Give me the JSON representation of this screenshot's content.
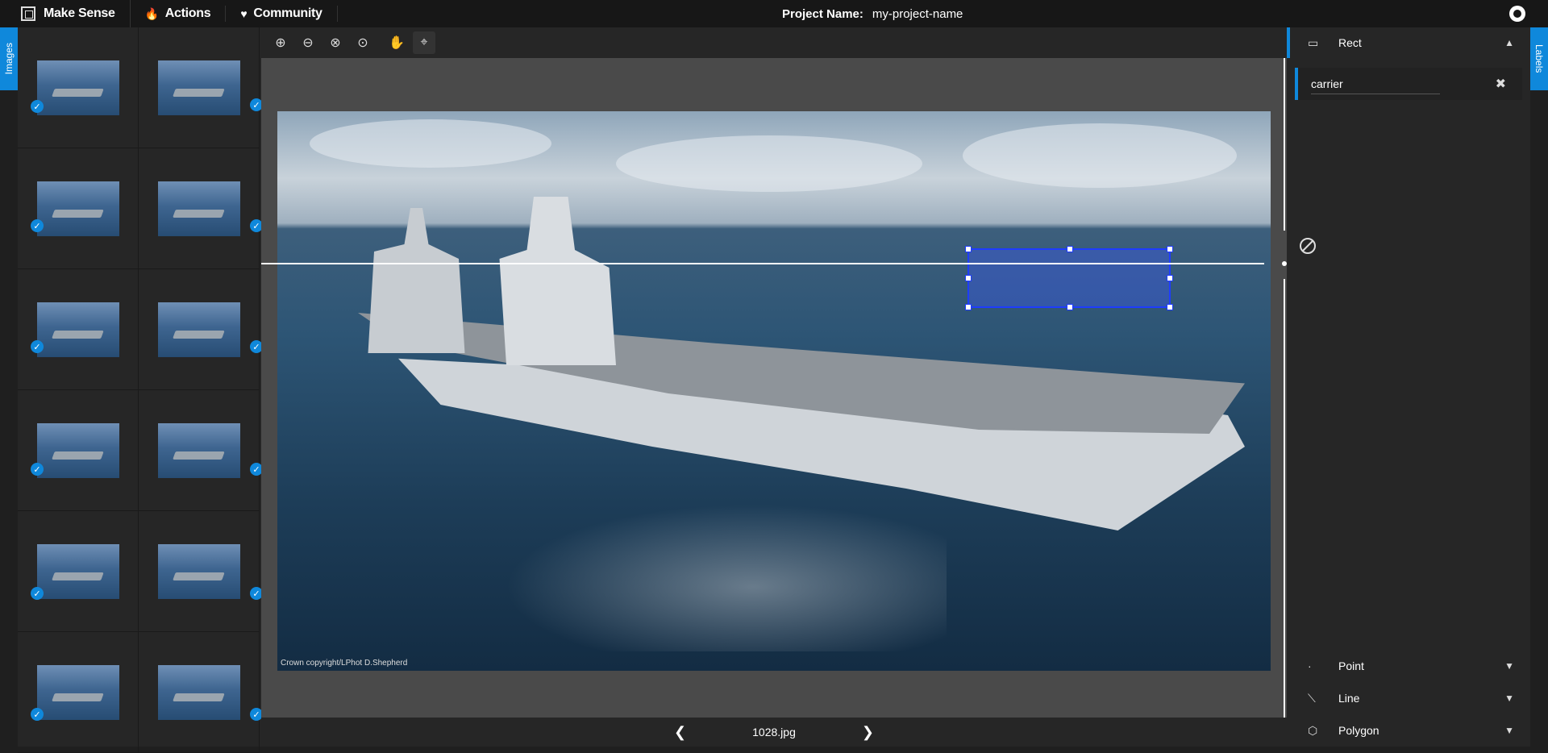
{
  "topbar": {
    "brand": "Make Sense",
    "menu": [
      {
        "label": "Actions",
        "icon": "flame-icon"
      },
      {
        "label": "Community",
        "icon": "heart-icon"
      }
    ],
    "project_label": "Project Name:",
    "project_name": "my-project-name"
  },
  "side_tabs": {
    "left": "Images",
    "right": "Labels"
  },
  "images_panel": {
    "thumbnails": [
      {
        "checked": true
      },
      {
        "checked": true
      },
      {
        "checked": true
      },
      {
        "checked": true
      },
      {
        "checked": true
      },
      {
        "checked": true
      },
      {
        "checked": true
      },
      {
        "checked": true
      },
      {
        "checked": true
      },
      {
        "checked": true
      },
      {
        "checked": true
      },
      {
        "checked": true
      }
    ]
  },
  "toolbar": {
    "tools": [
      "zoom-in-icon",
      "zoom-out-icon",
      "zoom-fit-icon",
      "zoom-max-icon",
      "hand-icon",
      "crosshair-icon"
    ]
  },
  "canvas": {
    "copyright": "Crown copyright/LPhot D.Shepherd"
  },
  "bottom_nav": {
    "filename": "1028.jpg"
  },
  "labels_panel": {
    "rect": {
      "title": "Rect",
      "labels": [
        "carrier"
      ]
    },
    "point": {
      "title": "Point"
    },
    "line": {
      "title": "Line"
    },
    "polygon": {
      "title": "Polygon"
    }
  },
  "colors": {
    "accent": "#0f88db",
    "bbox": "#1e3cff",
    "panel": "#262626",
    "topbar": "#171717"
  }
}
